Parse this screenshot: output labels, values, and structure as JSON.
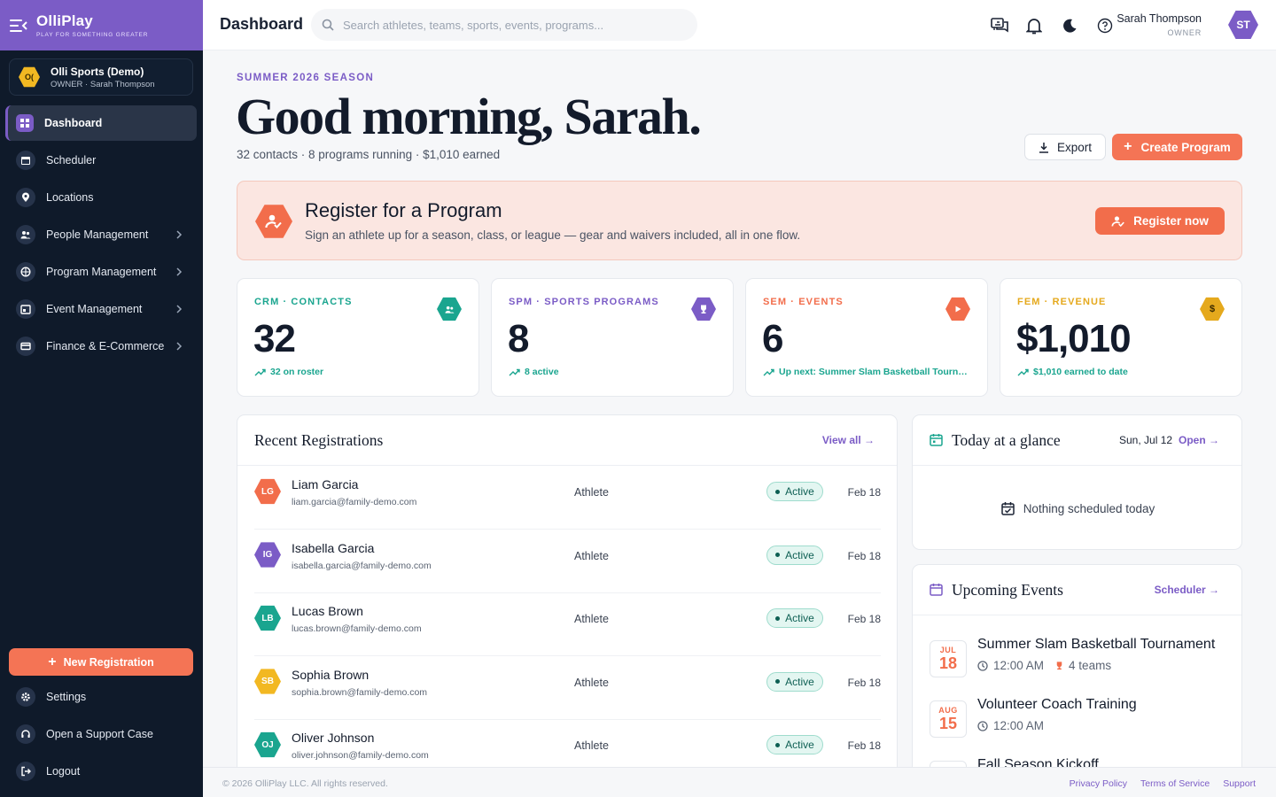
{
  "brand": {
    "name": "OlliPlay",
    "tagline": "PLAY FOR SOMETHING GREATER"
  },
  "org": {
    "badge": "O(",
    "name": "Olli Sports (Demo)",
    "subtitle": "OWNER · Sarah Thompson"
  },
  "nav": [
    {
      "label": "Dashboard",
      "icon": "dashboard-icon",
      "active": true,
      "submenu": false
    },
    {
      "label": "Scheduler",
      "icon": "calendar-icon",
      "active": false,
      "submenu": false
    },
    {
      "label": "Locations",
      "icon": "location-pin-icon",
      "active": false,
      "submenu": false
    },
    {
      "label": "People Management",
      "icon": "people-icon",
      "active": false,
      "submenu": true
    },
    {
      "label": "Program Management",
      "icon": "sports-ball-icon",
      "active": false,
      "submenu": true
    },
    {
      "label": "Event Management",
      "icon": "event-icon",
      "active": false,
      "submenu": true
    },
    {
      "label": "Finance & E-Commerce",
      "icon": "card-icon",
      "active": false,
      "submenu": true
    }
  ],
  "new_registration_label": "New Registration",
  "bottom_nav": [
    {
      "label": "Settings",
      "icon": "gear-icon"
    },
    {
      "label": "Open a Support Case",
      "icon": "support-icon"
    },
    {
      "label": "Logout",
      "icon": "logout-icon"
    }
  ],
  "topbar": {
    "title": "Dashboard",
    "search_placeholder": "Search athletes, teams, sports, events, programs...",
    "user_name": "Sarah Thompson",
    "user_role": "OWNER",
    "user_initials": "ST"
  },
  "hero": {
    "season": "SUMMER 2026 SEASON",
    "greeting": "Good morning, Sarah.",
    "summary": "32 contacts · 8 programs running · $1,010 earned",
    "export_label": "Export",
    "create_label": "Create Program"
  },
  "banner": {
    "title": "Register for a Program",
    "subtitle": "Sign an athlete up for a season, class, or league — gear and waivers included, all in one flow.",
    "button": "Register now"
  },
  "stats": [
    {
      "label": "CRM · CONTACTS",
      "value": "32",
      "foot": "32 on roster",
      "color": "#1aa58f",
      "icon": "people-icon"
    },
    {
      "label": "SPM · SPORTS PROGRAMS",
      "value": "8",
      "foot": "8 active",
      "color": "#7b5cc6",
      "icon": "trophy-icon"
    },
    {
      "label": "SEM · EVENTS",
      "value": "6",
      "foot": "Up next: Summer Slam Basketball Tournament",
      "color": "#f26d4b",
      "icon": "play-icon"
    },
    {
      "label": "FEM · REVENUE",
      "value": "$1,010",
      "foot": "$1,010 earned to date",
      "color": "#e5a91d",
      "icon": "dollar-icon"
    }
  ],
  "registrations": {
    "title": "Recent Registrations",
    "view_all": "View all →",
    "rows": [
      {
        "initials": "LG",
        "name": "Liam Garcia",
        "email": "liam.garcia@family-demo.com",
        "role": "Athlete",
        "status": "Active",
        "date": "Feb 18",
        "color": "#f26d4b"
      },
      {
        "initials": "IG",
        "name": "Isabella Garcia",
        "email": "isabella.garcia@family-demo.com",
        "role": "Athlete",
        "status": "Active",
        "date": "Feb 18",
        "color": "#7b5cc6"
      },
      {
        "initials": "LB",
        "name": "Lucas Brown",
        "email": "lucas.brown@family-demo.com",
        "role": "Athlete",
        "status": "Active",
        "date": "Feb 18",
        "color": "#1aa58f"
      },
      {
        "initials": "SB",
        "name": "Sophia Brown",
        "email": "sophia.brown@family-demo.com",
        "role": "Athlete",
        "status": "Active",
        "date": "Feb 18",
        "color": "#f2b822"
      },
      {
        "initials": "OJ",
        "name": "Oliver Johnson",
        "email": "oliver.johnson@family-demo.com",
        "role": "Athlete",
        "status": "Active",
        "date": "Feb 18",
        "color": "#1aa58f"
      }
    ]
  },
  "glance": {
    "title": "Today at a glance",
    "date": "Sun, Jul 12",
    "open": "Open →",
    "empty": "Nothing scheduled today"
  },
  "events": {
    "title": "Upcoming Events",
    "link": "Scheduler →",
    "items": [
      {
        "month": "JUL",
        "day": "18",
        "title": "Summer Slam Basketball Tournament",
        "time": "12:00 AM",
        "extra": "4 teams"
      },
      {
        "month": "AUG",
        "day": "15",
        "title": "Volunteer Coach Training",
        "time": "12:00 AM",
        "extra": ""
      },
      {
        "month": "SEP",
        "day": "",
        "title": "Fall Season Kickoff",
        "time": "",
        "extra": ""
      }
    ]
  },
  "footer": {
    "copyright": "© 2026 OlliPlay LLC. All rights reserved.",
    "links": [
      "Privacy Policy",
      "Terms of Service",
      "Support"
    ]
  }
}
